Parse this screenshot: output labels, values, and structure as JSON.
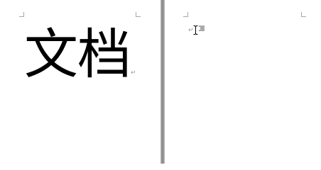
{
  "document": {
    "page1": {
      "text": "文档",
      "paragraph_mark": "↵"
    },
    "page2": {
      "text": "",
      "paragraph_mark": "↵"
    }
  },
  "icons": {
    "cursor": "text-ibeam-cursor-icon",
    "hint": "format-hint-icon"
  },
  "colors": {
    "page": "#ffffff",
    "gutter": "#8e8e8e",
    "marks": "#a8a8a8",
    "text": "#000000"
  }
}
